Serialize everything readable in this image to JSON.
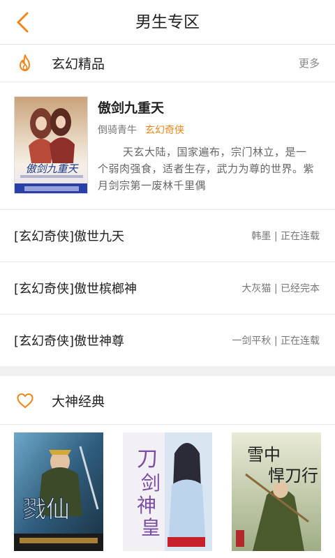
{
  "header": {
    "title": "男生专区",
    "back_icon": "chevron-left-icon",
    "accent": "#f08519"
  },
  "section1": {
    "icon": "flame-icon",
    "title": "玄幻精品",
    "more": "更多"
  },
  "featured": {
    "title": "傲剑九重天",
    "author": "倒骑青牛",
    "genre": "玄幻奇侠",
    "description": "天玄大陆，国家遍布，宗门林立，是一个弱肉强食，适者生存，武力为尊的世界。紫月剑宗第一废林千里偶",
    "cover_text": "傲剑九重天"
  },
  "list": [
    {
      "title": "[玄幻奇侠]傲世九天",
      "meta": "韩墨 | 正在连载"
    },
    {
      "title": "[玄幻奇侠]傲世槟榔神",
      "meta": "大灰猫 | 已经完本"
    },
    {
      "title": "[玄幻奇侠]傲世神尊",
      "meta": "一剑平秋 | 正在连载"
    }
  ],
  "section2": {
    "icon": "heart-icon",
    "title": "大神经典"
  },
  "shelf": [
    {
      "cover_text": "戮仙"
    },
    {
      "cover_text": "刀剑神皇"
    },
    {
      "cover_text": "雪中悍刀行"
    }
  ]
}
